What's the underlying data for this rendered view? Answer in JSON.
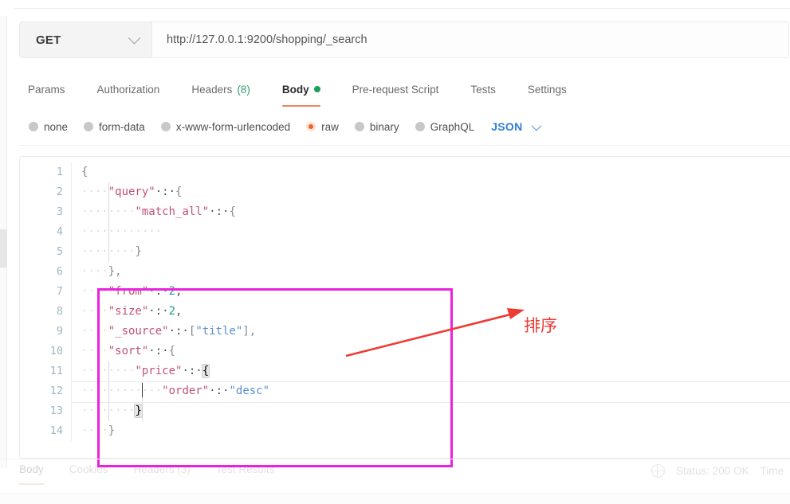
{
  "request": {
    "method": "GET",
    "method_caret_icon": "chevron-down-icon",
    "url": "http://127.0.0.1:9200/shopping/_search"
  },
  "request_tabs": [
    {
      "label": "Params",
      "active": false,
      "count": null,
      "dot": false
    },
    {
      "label": "Authorization",
      "active": false,
      "count": null,
      "dot": false
    },
    {
      "label": "Headers",
      "active": false,
      "count": "(8)",
      "dot": false
    },
    {
      "label": "Body",
      "active": true,
      "count": null,
      "dot": true
    },
    {
      "label": "Pre-request Script",
      "active": false,
      "count": null,
      "dot": false
    },
    {
      "label": "Tests",
      "active": false,
      "count": null,
      "dot": false
    },
    {
      "label": "Settings",
      "active": false,
      "count": null,
      "dot": false
    }
  ],
  "body_types": [
    {
      "label": "none",
      "selected": false
    },
    {
      "label": "form-data",
      "selected": false
    },
    {
      "label": "x-www-form-urlencoded",
      "selected": false
    },
    {
      "label": "raw",
      "selected": true
    },
    {
      "label": "binary",
      "selected": false
    },
    {
      "label": "GraphQL",
      "selected": false
    }
  ],
  "body_format": {
    "label": "JSON",
    "caret_icon": "chevron-down-icon"
  },
  "editor": {
    "line_numbers": [
      "1",
      "2",
      "3",
      "4",
      "5",
      "6",
      "7",
      "8",
      "9",
      "10",
      "11",
      "12",
      "13",
      "14"
    ],
    "lines": [
      {
        "n": 1,
        "tokens": [
          {
            "t": "{",
            "c": "br"
          }
        ]
      },
      {
        "n": 2,
        "tokens": [
          {
            "t": "····",
            "c": "ind"
          },
          {
            "t": "\"query\"",
            "c": "k"
          },
          {
            "t": "·:·",
            "c": "p"
          },
          {
            "t": "{",
            "c": "br"
          }
        ]
      },
      {
        "n": 3,
        "tokens": [
          {
            "t": "····",
            "c": "ind"
          },
          {
            "t": "····",
            "c": "ind"
          },
          {
            "t": "\"match_all\"",
            "c": "k"
          },
          {
            "t": "·:·",
            "c": "p"
          },
          {
            "t": "{",
            "c": "br"
          }
        ]
      },
      {
        "n": 4,
        "tokens": [
          {
            "t": "····",
            "c": "ind"
          },
          {
            "t": "········",
            "c": "ind"
          }
        ]
      },
      {
        "n": 5,
        "tokens": [
          {
            "t": "····",
            "c": "ind"
          },
          {
            "t": "····",
            "c": "ind"
          },
          {
            "t": "}",
            "c": "br"
          }
        ]
      },
      {
        "n": 6,
        "tokens": [
          {
            "t": "····",
            "c": "ind"
          },
          {
            "t": "},",
            "c": "br"
          }
        ]
      },
      {
        "n": 7,
        "tokens": [
          {
            "t": "····",
            "c": "ind"
          },
          {
            "t": "\"from\"",
            "c": "k"
          },
          {
            "t": "·:·",
            "c": "p"
          },
          {
            "t": "2",
            "c": "n"
          },
          {
            "t": ",",
            "c": "p"
          }
        ]
      },
      {
        "n": 8,
        "tokens": [
          {
            "t": "····",
            "c": "ind"
          },
          {
            "t": "\"size\"",
            "c": "k"
          },
          {
            "t": "·:·",
            "c": "p"
          },
          {
            "t": "2",
            "c": "n"
          },
          {
            "t": ",",
            "c": "p"
          }
        ]
      },
      {
        "n": 9,
        "tokens": [
          {
            "t": "····",
            "c": "ind"
          },
          {
            "t": "\"_source\"",
            "c": "k"
          },
          {
            "t": "·:·",
            "c": "p"
          },
          {
            "t": "[",
            "c": "br"
          },
          {
            "t": "\"title\"",
            "c": "s"
          },
          {
            "t": "],",
            "c": "br"
          }
        ]
      },
      {
        "n": 10,
        "tokens": [
          {
            "t": "····",
            "c": "ind"
          },
          {
            "t": "\"sort\"",
            "c": "k"
          },
          {
            "t": "·:·",
            "c": "p"
          },
          {
            "t": "{",
            "c": "br"
          }
        ]
      },
      {
        "n": 11,
        "tokens": [
          {
            "t": "····",
            "c": "ind"
          },
          {
            "t": "····",
            "c": "ind"
          },
          {
            "t": "\"price\"",
            "c": "k"
          },
          {
            "t": "·:·",
            "c": "p"
          },
          {
            "t": "{",
            "c": "mb"
          }
        ]
      },
      {
        "n": 12,
        "tokens": [
          {
            "t": "····",
            "c": "ind"
          },
          {
            "t": "····",
            "c": "ind"
          },
          {
            "t": "····",
            "c": "ind"
          },
          {
            "t": "\"order\"",
            "c": "k"
          },
          {
            "t": "·:·",
            "c": "p"
          },
          {
            "t": "\"desc\"",
            "c": "s"
          }
        ],
        "active": true
      },
      {
        "n": 13,
        "tokens": [
          {
            "t": "····",
            "c": "ind"
          },
          {
            "t": "····",
            "c": "ind"
          },
          {
            "t": "}",
            "c": "mb"
          }
        ]
      },
      {
        "n": 14,
        "tokens": [
          {
            "t": "····",
            "c": "ind"
          },
          {
            "t": "}",
            "c": "br"
          }
        ]
      }
    ]
  },
  "annotation": {
    "text": "排序",
    "box_color": "#ea21e0",
    "arrow_color": "#ee3b33"
  },
  "response": {
    "tabs": [
      {
        "label": "Body",
        "active": true
      },
      {
        "label": "Cookies",
        "active": false
      },
      {
        "label": "Headers (3)",
        "active": false
      },
      {
        "label": "Test Results",
        "active": false
      }
    ],
    "globe_icon": "globe-icon",
    "status": "Status: 200 OK",
    "time": "Time"
  }
}
